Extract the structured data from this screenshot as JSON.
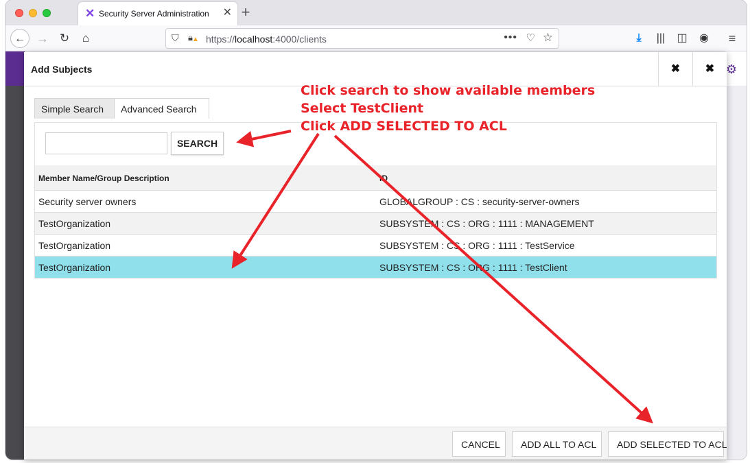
{
  "browser": {
    "tab_title": "Security Server Administration",
    "tab_close": "✕",
    "new_tab": "+",
    "url_scheme": "https://",
    "url_host": "localhost",
    "url_rest": ":4000/clients",
    "icons": [
      "back-icon",
      "forward-icon",
      "reload-icon",
      "home-icon",
      "shield-icon",
      "lock-warning-icon",
      "more-icon",
      "pocket-icon",
      "star-icon",
      "download-icon",
      "library-icon",
      "sidebar-icon",
      "account-icon",
      "menu-icon"
    ]
  },
  "dialog": {
    "title": "Add Subjects",
    "expand_icon": "✖",
    "close_icon": "✖",
    "tabs": [
      "Simple Search",
      "Advanced Search"
    ],
    "search": {
      "value": "",
      "button_label": "SEARCH"
    },
    "table": {
      "headers": [
        "Member Name/Group Description",
        "ID"
      ],
      "rows": [
        {
          "name": "Security server owners",
          "id": "GLOBALGROUP : CS : security-server-owners",
          "selected": false
        },
        {
          "name": "TestOrganization",
          "id": "SUBSYSTEM : CS : ORG : 1111 : MANAGEMENT",
          "selected": false
        },
        {
          "name": "TestOrganization",
          "id": "SUBSYSTEM : CS : ORG : 1111 : TestService",
          "selected": false
        },
        {
          "name": "TestOrganization",
          "id": "SUBSYSTEM : CS : ORG : 1111 : TestClient",
          "selected": true
        }
      ]
    },
    "footer": {
      "cancel": "CANCEL",
      "add_all": "ADD ALL TO ACL",
      "add_selected": "ADD SELECTED TO ACL"
    }
  },
  "annotation": {
    "lines": [
      "Click search to show available members",
      "Select TestClient",
      "Click ADD SELECTED TO ACL"
    ],
    "color": "#e8232a"
  },
  "colors": {
    "brand": "#5c2d91",
    "selected_row": "#90e0ec"
  }
}
